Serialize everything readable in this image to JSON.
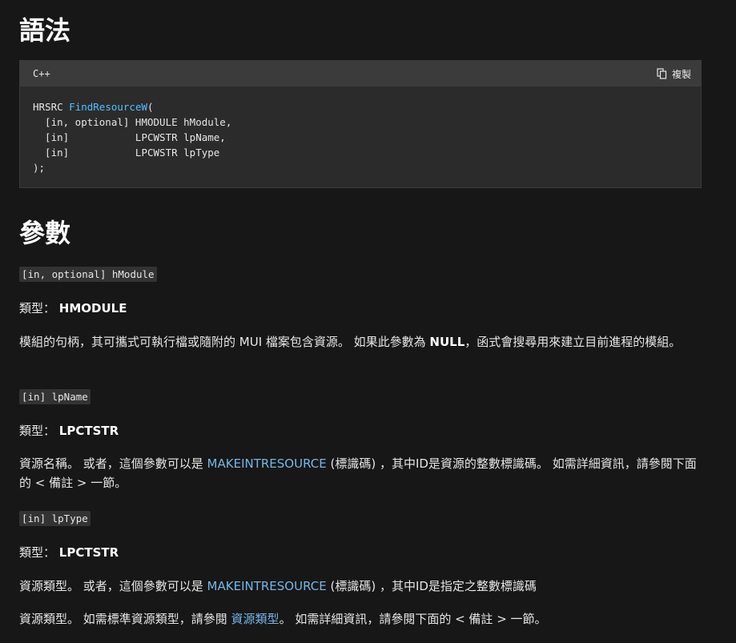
{
  "headings": {
    "syntax": "語法",
    "params": "參數"
  },
  "code_block": {
    "language": "C++",
    "copy_label": "複製",
    "return_type": "HRSRC",
    "function_name": "FindResourceW",
    "open_paren": "(",
    "lines": [
      "  [in, optional] HMODULE hModule,",
      "  [in]           LPCWSTR lpName,",
      "  [in]           LPCWSTR lpType"
    ],
    "close": ");"
  },
  "params": [
    {
      "chip": "[in, optional] hModule",
      "type_label": "類型：",
      "type_value": "HMODULE",
      "desc_before": "模組的句柄，其可攜式可執行檔或隨附的 MUI 檔案包含資源。 如果此參數為 ",
      "desc_bold": "NULL",
      "desc_after": "，函式會搜尋用來建立目前進程的模組。"
    },
    {
      "chip": "[in] lpName",
      "type_label": "類型：",
      "type_value": "LPCTSTR",
      "desc_before": "資源名稱。 或者，這個參數可以是 ",
      "desc_link": "MAKEINTRESOURCE",
      "desc_after": " (標識碼) ，其中ID是資源的整數標識碼。 如需詳細資訊，請參閱下面的 < 備註 > 一節。"
    },
    {
      "chip": "[in] lpType",
      "type_label": "類型：",
      "type_value": "LPCTSTR",
      "desc_before": "資源類型。 或者，這個參數可以是 ",
      "desc_link": "MAKEINTRESOURCE",
      "desc_after": " (標識碼) ，其中ID是指定之整數標識碼",
      "desc2_before": "資源類型。 如需標準資源類型，請參閱 ",
      "desc2_link": "資源類型",
      "desc2_after": "。 如需詳細資訊，請參閱下面的 < 備註 > 一節。"
    }
  ],
  "colors": {
    "background": "#171717",
    "code_bg": "#2b2b2b",
    "code_header_bg": "#3b3b3b",
    "function_name": "#4fc1ff",
    "link": "#75b6e7"
  }
}
